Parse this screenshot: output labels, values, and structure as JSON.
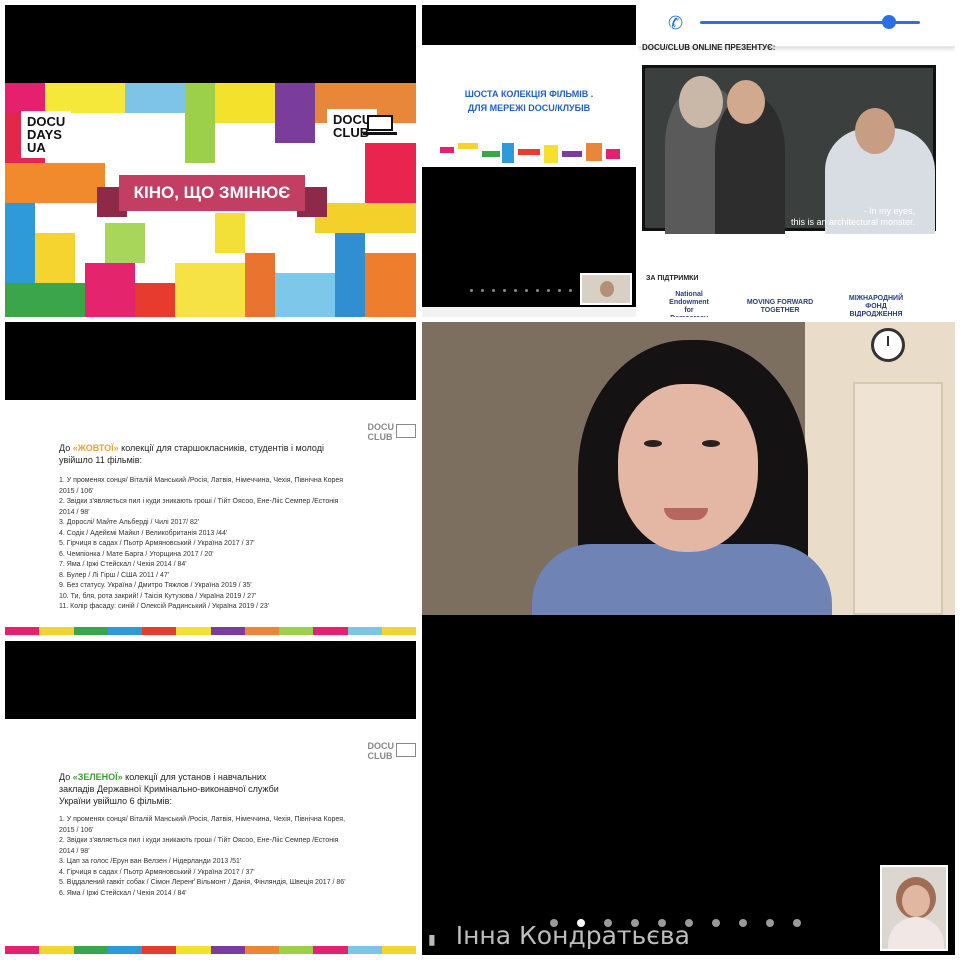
{
  "panel1": {
    "logo_left": "DOCU\nDAYS\nUA",
    "logo_right": "DOCU\nCLUB",
    "ribbon": "КІНО, ЩО ЗМІНЮЄ"
  },
  "panel2": {
    "headline_line1": "ШОСТА КОЛЕКЦІЯ ФІЛЬМІВ .",
    "headline_line2": "ДЛЯ МЕРЕЖІ DOCU/КЛУБІВ"
  },
  "panel3": {
    "presents": "DOCU/CLUB ONLINE ПРЕЗЕНТУЄ:",
    "subtitle_line1": "- In my eyes,",
    "subtitle_line2": "this is an architectural monster.",
    "support_label": "ЗА ПІДТРИМКИ",
    "sponsors": [
      "National Endowment for Democracy",
      "MOVING FORWARD TOGETHER",
      "МІЖНАРОДНИЙ ФОНД ВІДРОДЖЕННЯ"
    ],
    "icons": [
      "phone-icon"
    ]
  },
  "panel4": {
    "logo": "DOCU\nCLUB",
    "heading_pre": "До ",
    "heading_highlight": "«ЖОВТОЇ»",
    "heading_post": " колекції для старшокласників, студентів і молоді увійшло 11 фільмів:",
    "highlight_color": "#e2a72e",
    "films": [
      "1. У променях сонця/ Віталій Манський /Росія, Латвія, Німеччина, Чехія, Північна Корея 2015 / 106'",
      "2.  Звідки з'являється пил і куди зникають гроші / Тійт Оясоо, Ене-Лііс Семпер /Естонія 2014 / 98'",
      "3. Дорослі/ Майте Альберді / Чилі 2017/ 82'",
      "4. Содік / Адейємі Майкл / Великобританія 2013 /44'",
      "5. Гірчиця в садах / Пьотр Армяновський / Україна 2017 / 37'",
      "6. Чемпіонка / Мате Барга / Угорщина 2017 / 20'",
      "7. Яма / Іржі Стейскал / Чехія 2014 / 84'",
      "8. Булер / Лі Гірш / США 2011 / 47'",
      "9. Без статусу. Україна / Дмитро Тяжлов / Україна 2019 / 35'",
      "10. Ти, бля, рота закрий! / Таісія Кутузова / Україна 2019 / 27'",
      "11. Колір фасаду: синій / Олексій Радинський / Україна 2019 / 23'"
    ]
  },
  "panel5": {
    "logo": "DOCU\nCLUB",
    "heading_pre": "До ",
    "heading_highlight": "«ЗЕЛЕНОЇ»",
    "heading_post": " колекції для установ і навчальних закладів Державної Кримінально-виконавчої служби України увійшло 6 фільмів:",
    "highlight_color": "#3d9b35",
    "films": [
      "1. У променях сонця/ Віталій Манський /Росія, Латвія, Німеччина, Чехія, Північна Корея, 2015 / 106'",
      "2.  Звідки з'являється пил і куди зникають гроші / Тійт Оясоо, Ене-Лііс Семпер /Естонія 2014 / 98'",
      "3. Цап за голос /Ерун ван Велзен / Нідерланди 2013 /51'",
      "4. Гірчиця в садах / Пьотр Армяновський / Україна 2017 / 37'",
      "5. Віддалений гавкіт собак / Сімон Леренґ Вільмонт / Данія, Фінляндія, Швеція 2017 / 86'",
      "6. Яма / Іржі Стейскал / Чехія 2014 / 84'"
    ]
  },
  "panel6": {
    "participant_name": "Інна Кондратьєва",
    "page_dots_total": 10,
    "page_dots_active": 2
  }
}
